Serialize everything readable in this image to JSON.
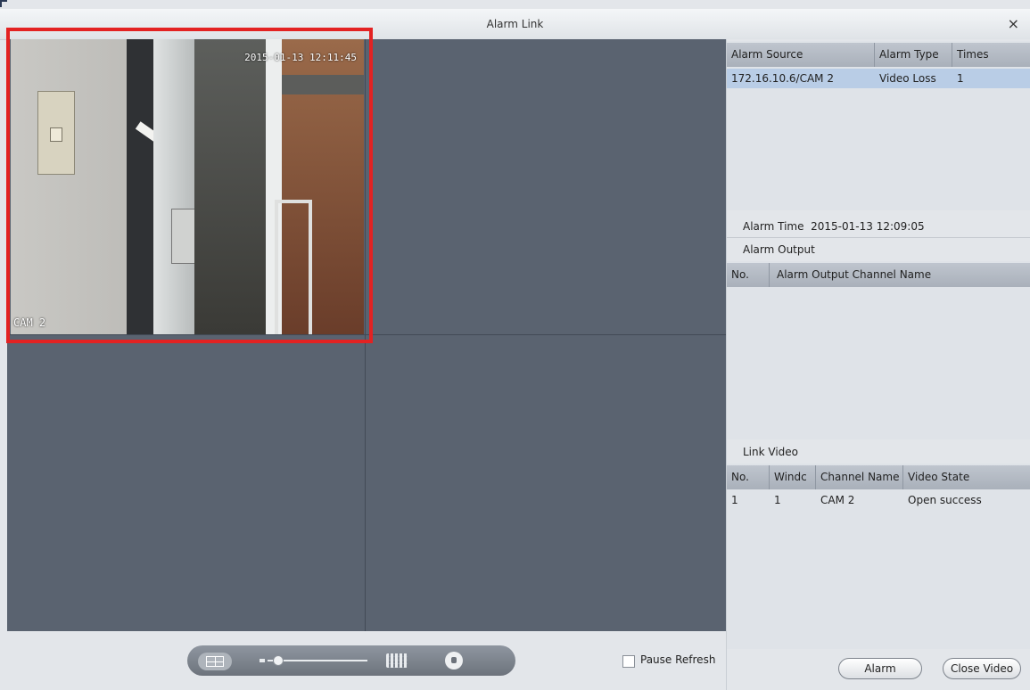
{
  "window": {
    "title": "Alarm Link",
    "close_symbol": "×"
  },
  "camera": {
    "timestamp": "2015-01-13 12:11:45",
    "name": "CAM 2",
    "highlight_color": "#e32222"
  },
  "controls": {
    "pause_refresh_label": "Pause Refresh",
    "pause_refresh_checked": false
  },
  "alarm_table": {
    "headers": [
      "Alarm Source",
      "Alarm Type",
      "Times"
    ],
    "rows": [
      {
        "source": "172.16.10.6/CAM 2",
        "type": "Video Loss",
        "times": "1"
      }
    ]
  },
  "alarm_time": {
    "label": "Alarm Time",
    "value": "2015-01-13 12:09:05"
  },
  "alarm_output": {
    "label": "Alarm Output",
    "headers": [
      "No.",
      "Alarm Output Channel Name"
    ],
    "rows": []
  },
  "link_video": {
    "label": "Link Video",
    "headers": [
      "No.",
      "Windc",
      "Channel Name",
      "Video State"
    ],
    "rows": [
      {
        "no": "1",
        "window": "1",
        "channel": "CAM 2",
        "state": "Open success"
      }
    ]
  },
  "buttons": {
    "alarm": "Alarm",
    "close_video": "Close Video"
  },
  "icons": [
    "layout-split-icon",
    "zoom-slider",
    "grid-layout-icon",
    "lock-icon",
    "close-icon"
  ]
}
